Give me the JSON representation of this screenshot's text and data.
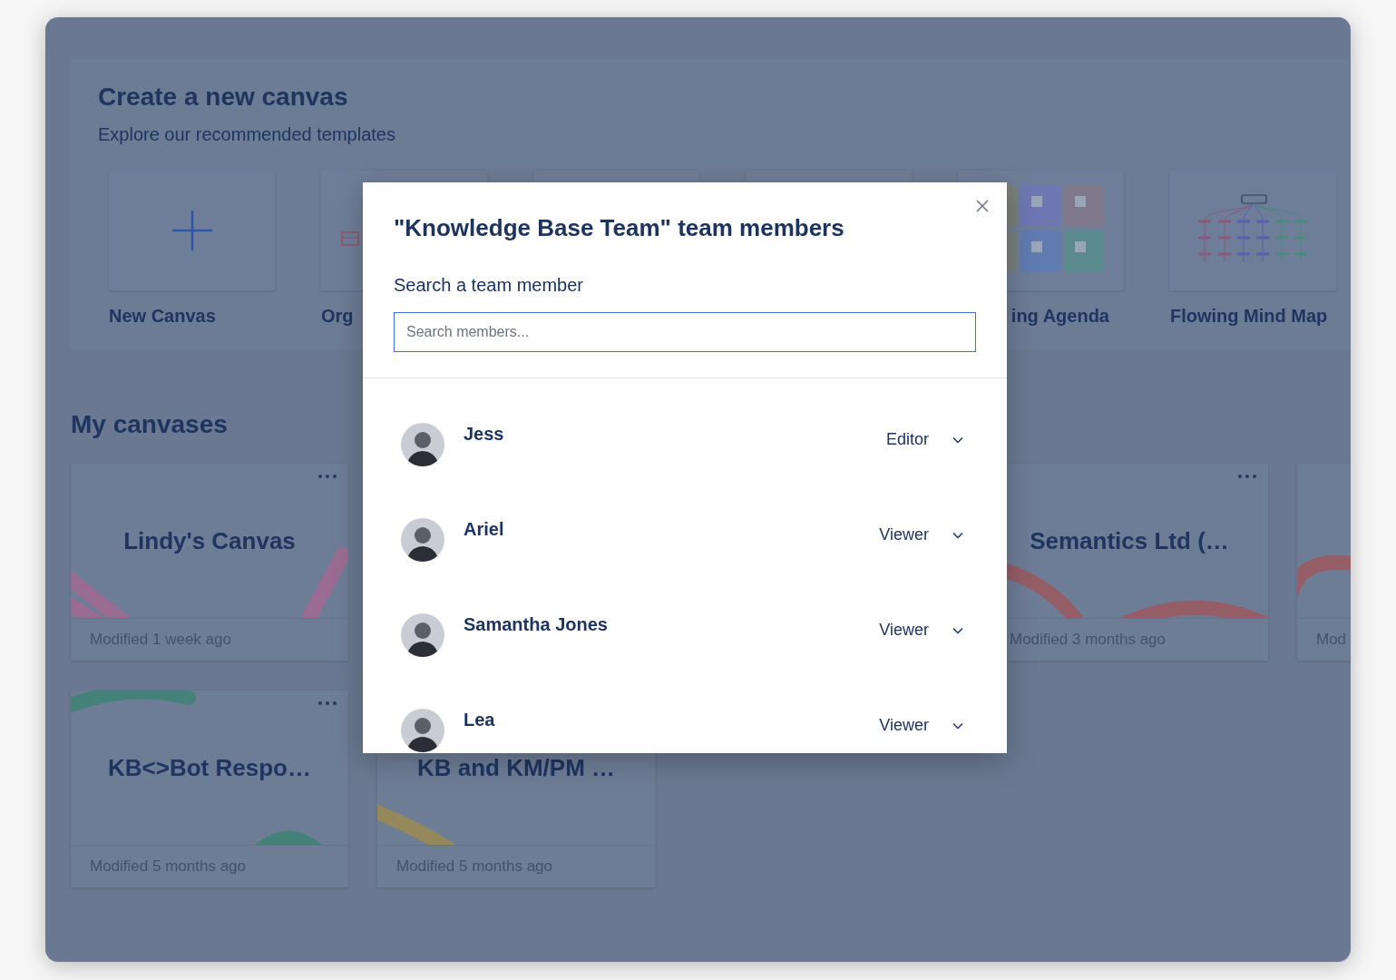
{
  "templates_section": {
    "title": "Create a new canvas",
    "subtitle": "Explore our recommended templates",
    "templates": [
      {
        "kind": "new",
        "label": "New Canvas"
      },
      {
        "kind": "org",
        "label": "Org"
      },
      {
        "kind": "hidden"
      },
      {
        "kind": "hidden"
      },
      {
        "kind": "agenda",
        "label": "ing Agenda"
      },
      {
        "kind": "mindmap",
        "label": "Flowing Mind Map"
      }
    ]
  },
  "my_canvases": {
    "title": "My canvases",
    "rows": [
      [
        {
          "title": "Lindy's Canvas",
          "modified": "Modified 1 week ago",
          "color": "#a06b93",
          "menu": true
        },
        {
          "title": "Semantics Ltd (…",
          "modified": "Modified 3 months ago",
          "color": "#9a5b63",
          "menu": true
        },
        {
          "modified": "Mod",
          "color": "#9a5b63",
          "menu": false
        }
      ],
      [
        {
          "title": "KB<>Bot Respo…",
          "modified": "Modified 5 months ago",
          "color": "#3f8276",
          "menu": true
        },
        {
          "title": "KB and KM/PM …",
          "modified": "Modified 5 months ago",
          "color": "#9a8a55",
          "menu": false
        }
      ]
    ]
  },
  "modal": {
    "title": "\"Knowledge Base Team\" team members",
    "search_label": "Search a team member",
    "search": {
      "placeholder": "Search members..."
    },
    "members": [
      {
        "name": "Jess",
        "role": "Editor"
      },
      {
        "name": "Ariel",
        "role": "Viewer"
      },
      {
        "name": "Samantha Jones",
        "role": "Viewer"
      },
      {
        "name": "Lea",
        "role": "Viewer"
      }
    ]
  }
}
